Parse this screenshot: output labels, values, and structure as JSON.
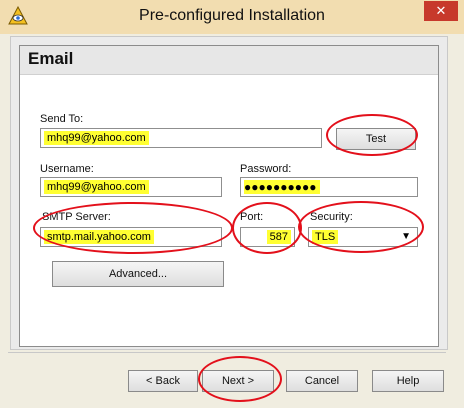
{
  "window": {
    "title": "Pre-configured Installation",
    "close_label": "✕"
  },
  "section": {
    "title": "Email"
  },
  "form": {
    "send_to": {
      "label": "Send To:",
      "value": "mhq99@yahoo.com"
    },
    "test_label": "Test",
    "username": {
      "label": "Username:",
      "value": "mhq99@yahoo.com"
    },
    "password": {
      "label": "Password:",
      "value": "●●●●●●●●●●"
    },
    "smtp": {
      "label": "SMTP Server:",
      "value": "smtp.mail.yahoo.com"
    },
    "port": {
      "label": "Port:",
      "value": "587"
    },
    "security": {
      "label": "Security:",
      "value": "TLS"
    },
    "advanced_label": "Advanced..."
  },
  "footer": {
    "back_label": "< Back",
    "next_label": "Next >",
    "cancel_label": "Cancel",
    "help_label": "Help"
  },
  "colors": {
    "highlight": "#ffff32",
    "annotation": "#e3101b",
    "titlebar": "#f2ddb0"
  }
}
